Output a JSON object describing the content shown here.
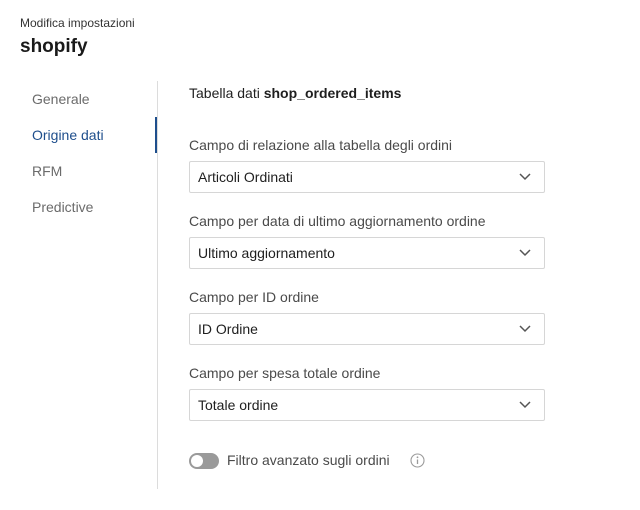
{
  "header": {
    "subtitle": "Modifica impostazioni",
    "title": "shopify"
  },
  "sidebar": {
    "items": [
      {
        "label": "Generale",
        "active": false
      },
      {
        "label": "Origine dati",
        "active": true
      },
      {
        "label": "RFM",
        "active": false
      },
      {
        "label": "Predictive",
        "active": false
      }
    ]
  },
  "main": {
    "table_prefix": "Tabella dati",
    "table_name": "shop_ordered_items",
    "fields": [
      {
        "label": "Campo di relazione alla tabella degli ordini",
        "value": "Articoli Ordinati"
      },
      {
        "label": "Campo per data di ultimo aggiornamento ordine",
        "value": "Ultimo aggiornamento"
      },
      {
        "label": "Campo per ID ordine",
        "value": "ID Ordine"
      },
      {
        "label": "Campo per spesa totale ordine",
        "value": "Totale ordine"
      }
    ],
    "advanced_filter": {
      "label": "Filtro avanzato sugli ordini",
      "enabled": false
    }
  },
  "icons": {
    "select_chevron": "chevron-down-icon",
    "info": "info-icon"
  },
  "colors": {
    "accent": "#1e4e8c",
    "toggle_off": "#9a9a9a"
  }
}
